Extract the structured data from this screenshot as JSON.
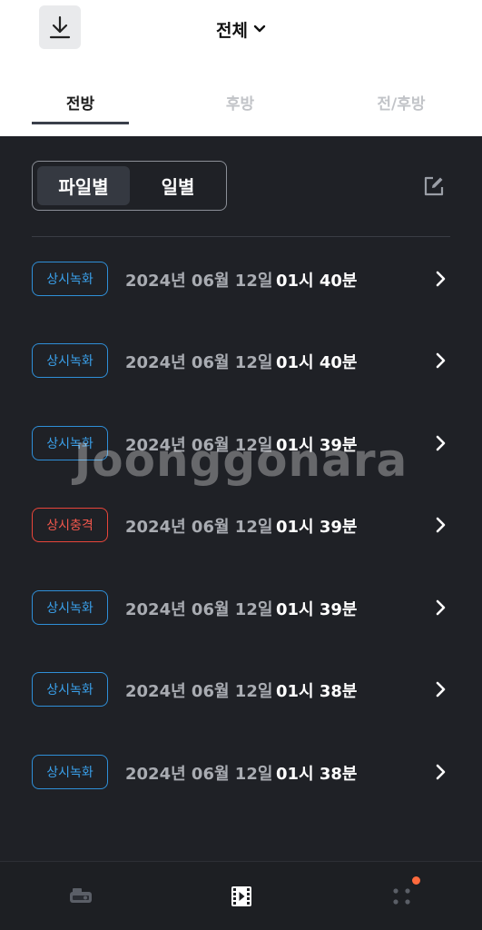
{
  "header": {
    "download_icon": "download-icon",
    "title": "전체",
    "title_icon": "chevron-down-icon",
    "tabs": [
      {
        "label": "전방",
        "active": true
      },
      {
        "label": "후방",
        "active": false
      },
      {
        "label": "전/후방",
        "active": false
      }
    ]
  },
  "filter": {
    "segments": [
      {
        "label": "파일별",
        "active": true
      },
      {
        "label": "일별",
        "active": false
      }
    ],
    "edit_icon": "edit-icon"
  },
  "records": [
    {
      "type": "상시녹화",
      "kind": "normal",
      "date": "2024년 06월 12일",
      "time": "01시 40분"
    },
    {
      "type": "상시녹화",
      "kind": "normal",
      "date": "2024년 06월 12일",
      "time": "01시 40분"
    },
    {
      "type": "상시녹화",
      "kind": "normal",
      "date": "2024년 06월 12일",
      "time": "01시 39분"
    },
    {
      "type": "상시충격",
      "kind": "impact",
      "date": "2024년 06월 12일",
      "time": "01시 39분"
    },
    {
      "type": "상시녹화",
      "kind": "normal",
      "date": "2024년 06월 12일",
      "time": "01시 39분"
    },
    {
      "type": "상시녹화",
      "kind": "normal",
      "date": "2024년 06월 12일",
      "time": "01시 38분"
    },
    {
      "type": "상시녹화",
      "kind": "normal",
      "date": "2024년 06월 12일",
      "time": "01시 38분"
    }
  ],
  "watermark": "Joonggonara",
  "bottom_nav": [
    {
      "icon": "dashcam-icon",
      "active": false
    },
    {
      "icon": "film-icon",
      "active": true
    },
    {
      "icon": "more-dots-icon",
      "active": false,
      "badge": true
    }
  ],
  "colors": {
    "background": "#1f2126",
    "normal_badge": "#2f8fd8",
    "impact_badge": "#e8453a",
    "notification_dot": "#ff6a3d"
  }
}
